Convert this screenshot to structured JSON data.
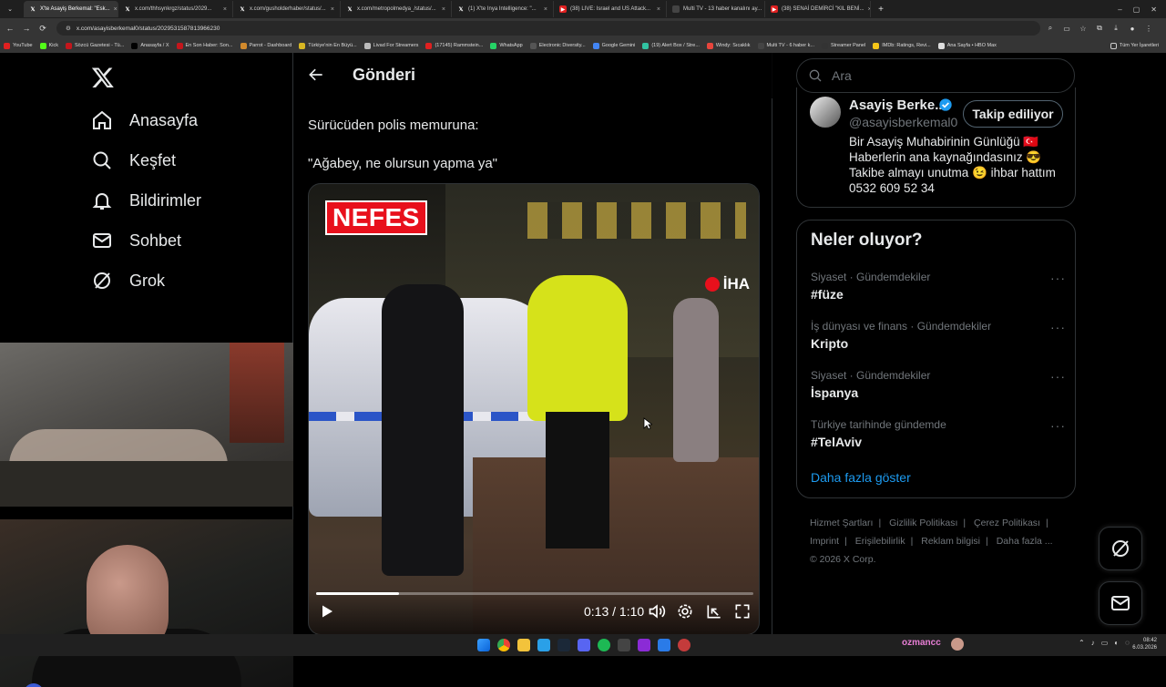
{
  "browser": {
    "tabs": [
      {
        "label": "X'te Asayiş Berkemal: \"Esk...",
        "icon": "x-icon",
        "active": true
      },
      {
        "label": "x.com/thhsynkrgz/status/2029...",
        "icon": "x-icon"
      },
      {
        "label": "x.com/gusholderhaber/status/...",
        "icon": "x-icon"
      },
      {
        "label": "x.com/metropolmedya_/status/...",
        "icon": "x-icon"
      },
      {
        "label": "(1) X'te Inya Intelligence: \"...",
        "icon": "x-icon"
      },
      {
        "label": "(38) LIVE: Israel and US Attack...",
        "icon": "youtube-icon"
      },
      {
        "label": "Multi TV - 13 haber kanalını ay...",
        "icon": "tv-icon"
      },
      {
        "label": "(38) SENAİ DEMİRCİ \"KIL BENİ...",
        "icon": "youtube-icon"
      }
    ],
    "url": "x.com/asayisberkemal0/status/2029531587813966230",
    "bookmarks": [
      "YouTube",
      "Kick",
      "Sözcü Gazetesi - Tü...",
      "Anasayfa / X",
      "En Son Haber: Son...",
      "Parrot - Dashboard",
      "Türkiye'nin En Büyü...",
      "Livad For Streamers",
      "(17145) Rammstein...",
      "WhatsApp",
      "Electronic Diversity...",
      "Google Gemini",
      "(19) Alert Box / Stre...",
      "Windy: Sıcaklık",
      "Multi TV - 6 haber k...",
      "Streamer Panel",
      "IMDb: Ratings, Revi...",
      "Ana Sayfa • HBO Max"
    ],
    "bookmarks_other": "Tüm Yer İşaretleri"
  },
  "leftnav": {
    "items": [
      {
        "label": "Anasayfa",
        "icon": "home-icon"
      },
      {
        "label": "Keşfet",
        "icon": "search-icon"
      },
      {
        "label": "Bildirimler",
        "icon": "bell-icon"
      },
      {
        "label": "Sohbet",
        "icon": "mail-icon"
      },
      {
        "label": "Grok",
        "icon": "grok-icon"
      }
    ]
  },
  "post": {
    "header_title": "Gönderi",
    "text_line1": "Sürücüden polis memuruna:",
    "text_line2": "\"Ağabey, ne olursun yapma ya\"",
    "video": {
      "overlay_logo": "NEFES",
      "watermark": "İHA",
      "time": "0:13 / 1:10",
      "progress": 0.19
    }
  },
  "right": {
    "search_placeholder": "Ara",
    "profile": {
      "name": "Asayiş Berke...",
      "handle": "@asayisberkemal0",
      "follow_label": "Takip ediliyor",
      "bio": [
        "Bir Asayiş Muhabirinin Günlüğü 🇹🇷",
        "Haberlerin ana kaynağındasınız 😎",
        "Takibe almayı unutma 😉 ihbar hattım",
        "0532 609 52 34"
      ]
    },
    "trends_title": "Neler oluyor?",
    "trends": [
      {
        "context": "Siyaset · Gündemdekiler",
        "name": "#füze"
      },
      {
        "context": "İş dünyası ve finans · Gündemdekiler",
        "name": "Kripto"
      },
      {
        "context": "Siyaset · Gündemdekiler",
        "name": "İspanya"
      },
      {
        "context": "Türkiye tarihinde gündemde",
        "name": "#TelAviv"
      }
    ],
    "show_more": "Daha fazla göster",
    "footer": {
      "links": [
        "Hizmet Şartları",
        "Gizlilik Politikası",
        "Çerez Politikası",
        "Imprint",
        "Erişilebilirlik",
        "Reklam bilgisi",
        "Daha fazla ..."
      ],
      "copyright": "© 2026 X Corp."
    }
  },
  "taskbar": {
    "streamer": "ozmancc",
    "time": "08:42",
    "date": "6.03.2026"
  },
  "colors": {
    "accent": "#1d9bf0",
    "background": "#000000",
    "border": "#2f3336",
    "muted": "#71767b"
  }
}
